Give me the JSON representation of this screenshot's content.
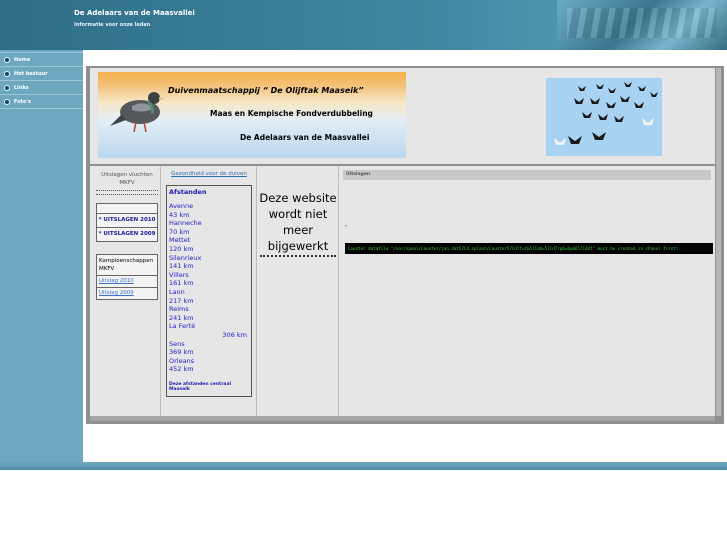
{
  "header": {
    "title": "De Adelaars van de Maasvallei",
    "subtitle": "Informatie voor onze leden"
  },
  "sidebar": {
    "items": [
      {
        "label": "Home"
      },
      {
        "label": "Het bestuur"
      },
      {
        "label": "Links"
      },
      {
        "label": "Foto's"
      }
    ]
  },
  "banner": {
    "line1": "Duivenmaatschappij  “ De  Olijftak Maaseik”",
    "line2": "Maas en Kempische Fondverdubbeling",
    "line3": "De Adelaars van de Maasvallei"
  },
  "left_col": {
    "uitslagen_title": "Uitslagen vluchten MKFV",
    "links": [
      "* UITSLAGEN 2010",
      "* UITSLAGEN 2009"
    ],
    "kampioen_header": "Kampioenschappen MKFV",
    "kampioen_links": [
      "Uitslag 2010",
      "Uitslag 2009"
    ]
  },
  "mid_col": {
    "gezondheid_link": "Gezondheid voor de duiven",
    "afstanden_title": "Afstanden",
    "afstanden": [
      {
        "place": "Avenne",
        "km": "43 km"
      },
      {
        "place": "Hanneche",
        "km": "70 km"
      },
      {
        "place": "Mettet",
        "km": "120 km"
      },
      {
        "place": "Silenrieux",
        "km": "141 km"
      },
      {
        "place": "Villers",
        "km": "161 km"
      },
      {
        "place": "Laon",
        "km": "217 km"
      },
      {
        "place": "Reims",
        "km": "241 km"
      },
      {
        "place": "La Ferté",
        "km": "306 km"
      },
      {
        "place": "Sens",
        "km": "369 km"
      },
      {
        "place": "Orleans",
        "km": "452 km"
      }
    ],
    "afstanden_footer": "Deze afstanden centraal Maaseik"
  },
  "notice": {
    "text_lines": [
      "Deze website",
      "wordt niet",
      "meer",
      "bijgewerkt"
    ]
  },
  "right_col": {
    "uitslagen_label": "Uitslagen",
    "mark": "\"",
    "counter_text": "Counter datafile \"/var/spool/Counter/jan.dat57Cd.splash/Counter57Cd?f=t&57Cdd=57Cd7rg6=0y&657Cddf\" must be created in cPanel first!"
  },
  "colors": {
    "header_bg": "#3f88a3",
    "sidebar_bg": "#6ea8c0",
    "link_blue": "#2323c8",
    "counter_green": "#39d239"
  }
}
